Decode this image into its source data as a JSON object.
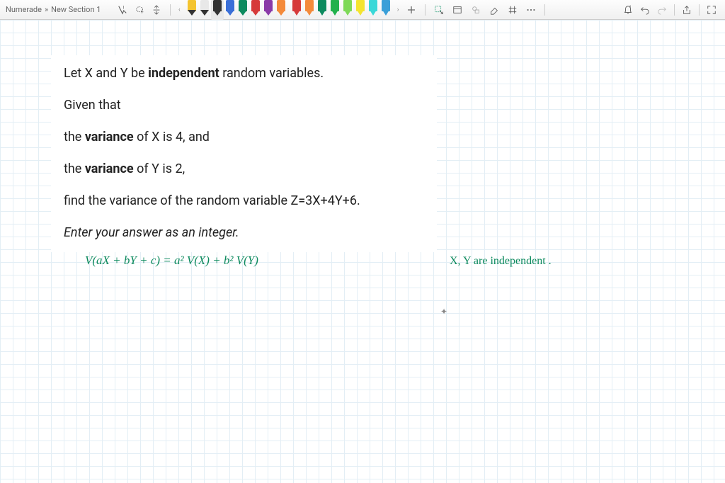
{
  "breadcrumb": {
    "app": "Numerade",
    "sep": "»",
    "section": "New Section 1"
  },
  "pens_fine": [
    {
      "body": "#f4c430",
      "tip": "#333"
    },
    {
      "body": "#e8e8e8",
      "tip": "#333"
    },
    {
      "body": "#333",
      "tip": "#333",
      "selected": true
    },
    {
      "body": "#3a6fd8",
      "tip": "#3a6fd8"
    },
    {
      "body": "#0d8a5e",
      "tip": "#0d8a5e"
    },
    {
      "body": "#d63a3a",
      "tip": "#d63a3a"
    },
    {
      "body": "#8a3aa8",
      "tip": "#8a3aa8"
    },
    {
      "body": "#f48a3a",
      "tip": "#f48a3a"
    }
  ],
  "pens_marker": [
    {
      "body": "#d63a3a",
      "tip": "#d63a3a"
    },
    {
      "body": "#f48a3a",
      "tip": "#f48a3a"
    },
    {
      "body": "#0d8a5e",
      "tip": "#0d8a5e"
    },
    {
      "body": "#22b14c",
      "tip": "#22b14c"
    },
    {
      "body": "#7ed957",
      "tip": "#7ed957"
    },
    {
      "body": "#f4e430",
      "tip": "#f4e430"
    },
    {
      "body": "#3ad8d8",
      "tip": "#3ad8d8"
    },
    {
      "body": "#3a9fd8",
      "tip": "#3a9fd8"
    }
  ],
  "problem": {
    "line1_a": "Let X and Y be ",
    "line1_b": "independent",
    "line1_c": " random variables.",
    "line2": "Given that",
    "line3_a": "the ",
    "line3_b": "variance",
    "line3_c": " of X is 4, and",
    "line4_a": "the ",
    "line4_b": "variance",
    "line4_c": " of Y is 2,",
    "line5": "find the variance of the random variable Z=3X+4Y+6.",
    "line6": "Enter your answer as an integer."
  },
  "handwriting": {
    "formula": "V(aX + bY + c)  =  a² V(X) + b² V(Y)",
    "note": "X, Y  are  independent ."
  }
}
